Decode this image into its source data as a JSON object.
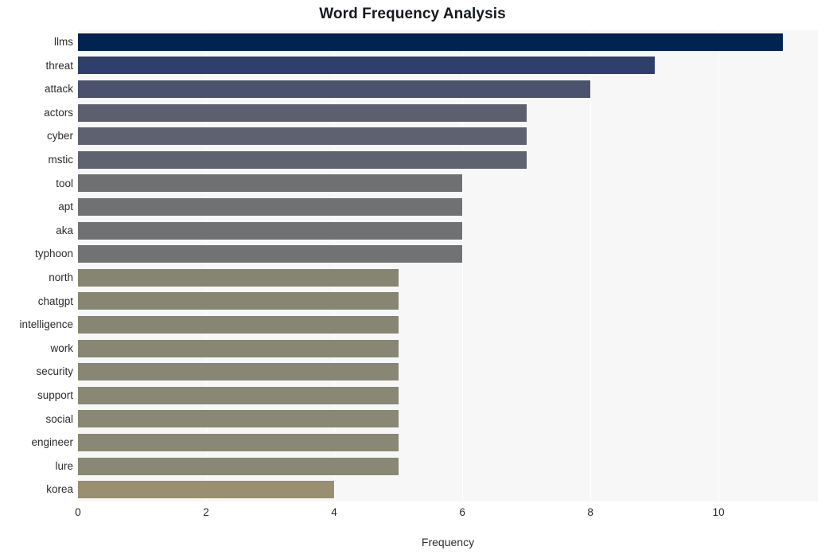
{
  "chart_data": {
    "type": "bar",
    "orientation": "horizontal",
    "title": "Word Frequency Analysis",
    "xlabel": "Frequency",
    "ylabel": "",
    "categories": [
      "llms",
      "threat",
      "attack",
      "actors",
      "cyber",
      "mstic",
      "tool",
      "apt",
      "aka",
      "typhoon",
      "north",
      "chatgpt",
      "intelligence",
      "work",
      "security",
      "support",
      "social",
      "engineer",
      "lure",
      "korea"
    ],
    "values": [
      11,
      9,
      8,
      7,
      7,
      7,
      6,
      6,
      6,
      6,
      5,
      5,
      5,
      5,
      5,
      5,
      5,
      5,
      5,
      4
    ],
    "bar_colors": [
      "#00234f",
      "#2e3f6b",
      "#4a526e",
      "#5c606e",
      "#5e6270",
      "#5f636f",
      "#6e7072",
      "#6f7173",
      "#6f7173",
      "#707274",
      "#858572",
      "#868672",
      "#868672",
      "#878773",
      "#878773",
      "#888874",
      "#888874",
      "#888874",
      "#888874",
      "#9a8f6f"
    ],
    "xlim": [
      0,
      11.55
    ],
    "xticks": [
      "0",
      "2",
      "4",
      "6",
      "8",
      "10"
    ],
    "xtick_values": [
      0,
      2,
      4,
      6,
      8,
      10
    ],
    "grid": true,
    "grid_axis": "x",
    "grid_color": "#ffffff",
    "plot_background": "#f7f7f8",
    "figure_background": "#ffffff",
    "legend": null
  }
}
